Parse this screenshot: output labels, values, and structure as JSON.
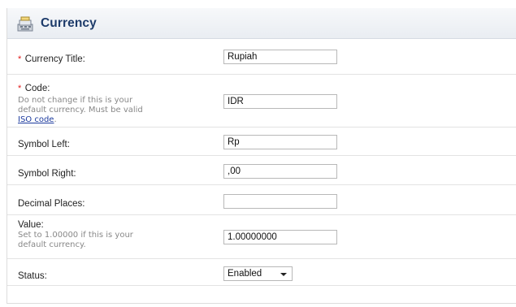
{
  "heading": {
    "title": "Currency",
    "icon": "cash-register-icon"
  },
  "form": {
    "title": {
      "required_mark": "*",
      "label": "Currency Title:",
      "value": "Rupiah"
    },
    "code": {
      "required_mark": "*",
      "label": "Code:",
      "help_line1": "Do not change if this is your",
      "help_line2": "default currency. Must be valid",
      "help_link": "ISO code",
      "help_end": ".",
      "value": "IDR"
    },
    "symbol_left": {
      "label": "Symbol Left:",
      "value": "Rp"
    },
    "symbol_right": {
      "label": "Symbol Right:",
      "value": ",00"
    },
    "decimal_places": {
      "label": "Decimal Places:",
      "value": ""
    },
    "value": {
      "label": "Value:",
      "help_line1": "Set to 1.00000 if this is your",
      "help_line2": "default currency.",
      "value": "1.00000000"
    },
    "status": {
      "label": "Status:",
      "selected": "Enabled"
    }
  },
  "colors": {
    "heading_text": "#1d3b6a",
    "required": "#e21b1b",
    "link": "#1d3b9e"
  }
}
